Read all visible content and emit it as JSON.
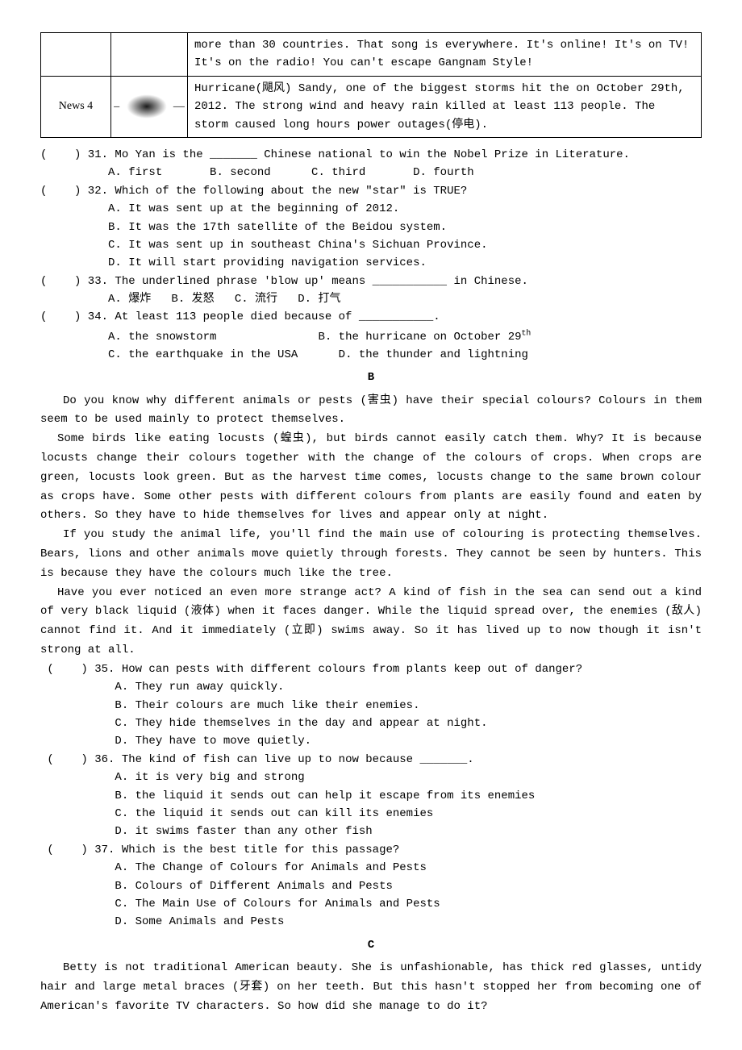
{
  "table": {
    "row1_text": "more than 30 countries. That song is everywhere. It's online! It's on TV! It's on the radio! You can't escape Gangnam Style!",
    "row2_label": "News 4",
    "row2_text": "Hurricane(飓风) Sandy, one of the biggest storms hit the on October 29th, 2012. The strong wind and heavy rain killed at least 113 people. The storm caused long hours power outages(停电)."
  },
  "qA": {
    "q31": "(    ) 31. Mo Yan is the _______ Chinese national to win the Nobel Prize in Literature.",
    "q31opts": "          A. first       B. second      C. third       D. fourth",
    "q32": "(    ) 32. Which of the following about the new \"star\" is TRUE?",
    "q32a": "          A. It was sent up at the beginning of 2012.",
    "q32b": "          B. It was the 17th satellite of the Beidou system.",
    "q32c": "          C. It was sent up in southeast China's Sichuan Province.",
    "q32d": "          D. It will start providing navigation services.",
    "q33": "(    ) 33. The underlined phrase 'blow up' means ___________ in Chinese.",
    "q33opts": "          A. 爆炸   B. 发怒   C. 流行   D. 打气",
    "q34": "(    ) 34. At least 113 people died because of ___________.",
    "q34a": "          A. the snowstorm               B. the hurricane on October 29",
    "q34a_sup": "th",
    "q34b": "          C. the earthquake in the USA      D. the thunder and lightning"
  },
  "headingB": "B",
  "passageB": {
    "p1": "Do you know why different animals or pests (害虫) have their special colours? Colours in them seem to be used mainly to protect themselves.",
    "p2": "Some birds like eating locusts (蝗虫), but birds cannot easily catch them. Why? It is because locusts change their colours together with the change of the colours of crops. When crops are green, locusts look green. But as the harvest time comes, locusts change to the same brown colour as crops have. Some other pests with different colours from plants are easily found and eaten by others. So they have to hide themselves for lives and appear only at night.",
    "p3": "If you study the animal life, you'll find the main use of colouring is protecting themselves. Bears, lions and other animals move quietly through forests. They cannot be seen by hunters. This is because they have the colours much like the tree.",
    "p4": "Have you ever noticed an even more strange act? A kind of fish in the sea can send out a kind of very black liquid (液体) when it faces danger. While the liquid spread over, the enemies (敌人) cannot find it. And it immediately (立即) swims away. So it has lived up to now though it isn't strong at all."
  },
  "qB": {
    "q35": " (    ) 35. How can pests with different colours from plants keep out of danger?",
    "q35a": "           A. They run away quickly.",
    "q35b": "           B. Their colours are much like their enemies.",
    "q35c": "           C. They hide themselves in the day and appear at night.",
    "q35d": "           D. They have to move quietly.",
    "q36": " (    ) 36. The kind of fish can live up to now because _______.",
    "q36a": "           A. it is very big and strong",
    "q36b": "           B. the liquid it sends out can help it escape from its enemies",
    "q36c": "           C. the liquid it sends out can kill its enemies",
    "q36d": "           D. it swims faster than any other fish",
    "q37": " (    ) 37. Which is the best title for this passage?",
    "q37a": "           A. The Change of Colours for Animals and Pests",
    "q37b": "           B. Colours of Different Animals and Pests",
    "q37c": "           C. The Main Use of Colours for Animals and Pests",
    "q37d": "           D. Some Animals and Pests"
  },
  "headingC": "C",
  "passageC": {
    "p1": "Betty is not traditional American beauty. She is unfashionable, has thick red glasses, untidy hair and large metal braces (牙套) on her teeth. But this hasn't stopped her from becoming one of American's favorite TV characters. So how did she manage to do it?"
  }
}
